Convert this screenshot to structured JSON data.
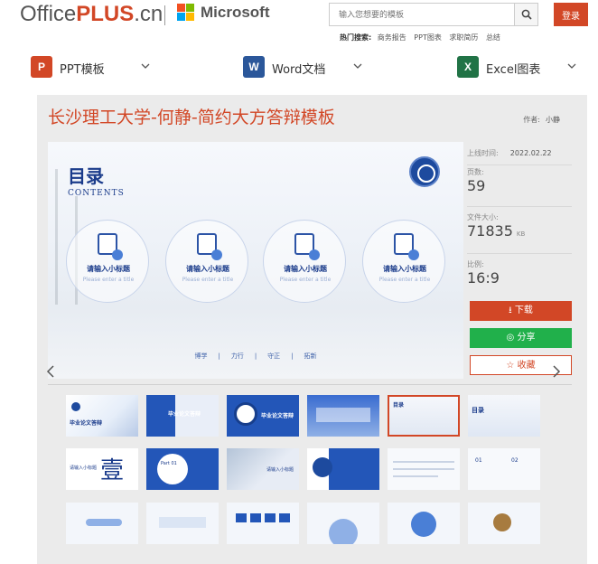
{
  "header": {
    "logo_main": "Office",
    "logo_plus": "PLUS",
    "logo_suffix": ".cn",
    "ms_text": "Microsoft",
    "search_placeholder": "输入您想要的模板",
    "login": "登录",
    "hot_label": "热门搜索:",
    "hot_items": [
      "商务报告",
      "PPT图表",
      "求职简历",
      "总结"
    ]
  },
  "nav": {
    "ppt": {
      "icon": "P",
      "label": "PPT模板",
      "color": "#d24726"
    },
    "word": {
      "icon": "W",
      "label": "Word文档",
      "color": "#2b579a"
    },
    "excel": {
      "icon": "X",
      "label": "Excel图表",
      "color": "#217346"
    }
  },
  "detail": {
    "title": "长沙理工大学-何静-简约大方答辩模板",
    "author_label": "作者:",
    "author_name": "小静",
    "date_label": "上线时间:",
    "date_value": "2022.02.22",
    "pages_label": "页数:",
    "pages_value": "59",
    "size_label": "文件大小:",
    "size_value": "71835",
    "size_unit": "KB",
    "ratio_label": "比例:",
    "ratio_value": "16:9",
    "download": "下载",
    "share": "分享",
    "favorite": "收藏"
  },
  "preview": {
    "title": "目录",
    "subtitle": "CONTENTS",
    "items": [
      {
        "t1": "请输入小标题",
        "t2": "Please enter a title"
      },
      {
        "t1": "请输入小标题",
        "t2": "Please enter a title"
      },
      {
        "t1": "请输入小标题",
        "t2": "Please enter a title"
      },
      {
        "t1": "请输入小标题",
        "t2": "Please enter a title"
      }
    ],
    "footer": [
      "博学",
      "|",
      "力行",
      "|",
      "守正",
      "|",
      "拓新"
    ]
  },
  "thumbs": {
    "t1": "毕业论文答辩",
    "t2": "Part 01",
    "t3": "请输入小标题",
    "t4": "壹",
    "t5": "目录",
    "t6": "01",
    "t7": "02"
  },
  "colors": {
    "accent": "#d24726",
    "share": "#21b04b",
    "blue": "#1a3b8b"
  }
}
